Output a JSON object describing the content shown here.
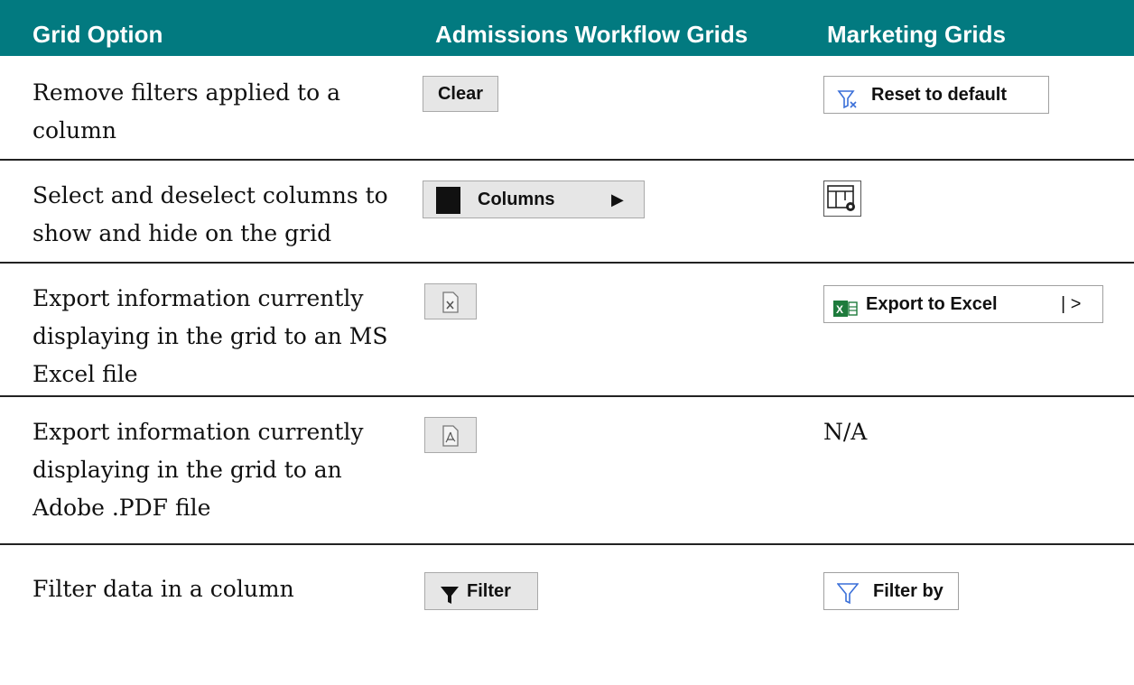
{
  "header": {
    "col1": "Grid Option",
    "col2": "Admissions Workflow Grids",
    "col3": "Marketing Grids"
  },
  "rows": [
    {
      "description": "Remove filters applied to a column",
      "admissions": {
        "label": "Clear"
      },
      "marketing": {
        "label": "Reset to default",
        "icon": "filter-clear-icon"
      }
    },
    {
      "description": "Select and deselect columns to show and hide on the grid",
      "admissions": {
        "label": "Columns",
        "icon": "column-block-icon",
        "arrow": "▶"
      },
      "marketing": {
        "icon": "grid-settings-icon"
      }
    },
    {
      "description": "Export information currently displaying in the grid to an MS Excel file",
      "admissions": {
        "icon": "excel-file-icon"
      },
      "marketing": {
        "label": "Export to Excel",
        "suffix": "| >",
        "icon": "excel-export-icon"
      }
    },
    {
      "description": "Export information currently displaying in the grid to an Adobe .PDF file",
      "admissions": {
        "icon": "pdf-file-icon"
      },
      "marketing": {
        "text": "N/A"
      }
    },
    {
      "description": "Filter data in a column",
      "admissions": {
        "label": "Filter",
        "icon": "filter-icon"
      },
      "marketing": {
        "label": "Filter by",
        "icon": "filter-outline-icon"
      }
    }
  ],
  "colors": {
    "header_bg": "#027a80",
    "excel_green": "#1e7b3c",
    "filter_blue": "#3a6fd8"
  }
}
